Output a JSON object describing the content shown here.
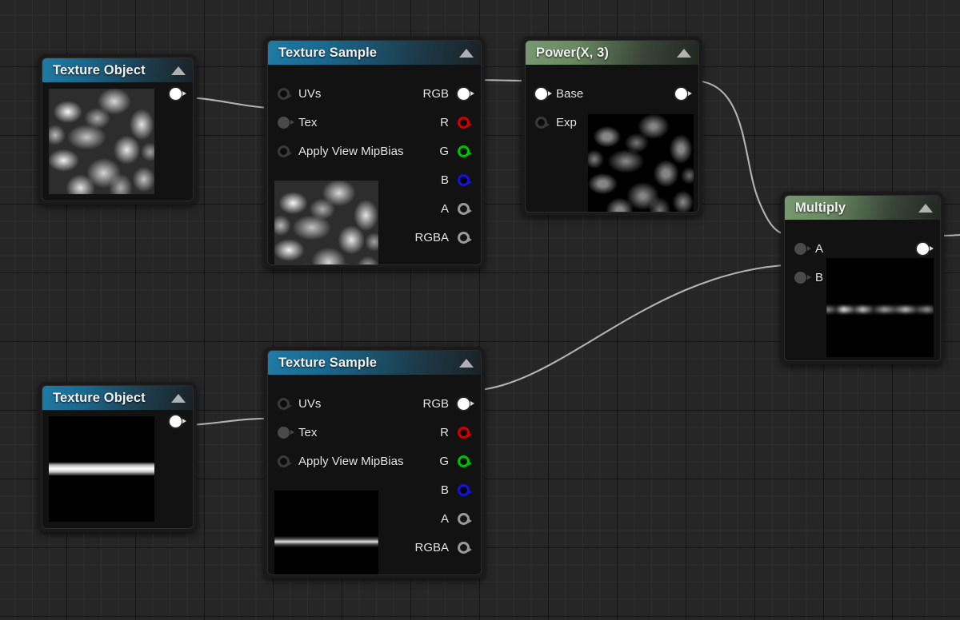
{
  "graph": {
    "editor": "material-node-graph",
    "background_color": "#262626",
    "wire_color": "#b4b4b4",
    "title_color_texture": "#1e7ba6",
    "title_color_math": "#78996f"
  },
  "nodes": {
    "texture_object_top": {
      "title": "Texture Object",
      "header_style": "blue",
      "outputs": [
        {
          "label": "",
          "pin": "white"
        }
      ],
      "thumbnail": "noise-cloud-grayscale"
    },
    "texture_sample_top": {
      "title": "Texture Sample",
      "header_style": "blue",
      "inputs": [
        {
          "label": "UVs",
          "pin": "hollow"
        },
        {
          "label": "Tex",
          "pin": "gray"
        },
        {
          "label": "Apply View MipBias",
          "pin": "hollow"
        }
      ],
      "outputs": [
        {
          "label": "RGB",
          "pin": "white"
        },
        {
          "label": "R",
          "pin": "red"
        },
        {
          "label": "G",
          "pin": "green"
        },
        {
          "label": "B",
          "pin": "blue"
        },
        {
          "label": "A",
          "pin": "grayring"
        },
        {
          "label": "RGBA",
          "pin": "grayring"
        }
      ],
      "thumbnail": "noise-cloud-grayscale"
    },
    "power": {
      "title": "Power(X, 3)",
      "header_style": "green",
      "inputs": [
        {
          "label": "Base",
          "pin": "white"
        },
        {
          "label": "Exp",
          "pin": "hollow"
        }
      ],
      "outputs": [
        {
          "label": "",
          "pin": "white"
        }
      ],
      "thumbnail": "noise-cloud-darkened"
    },
    "texture_object_bottom": {
      "title": "Texture Object",
      "header_style": "blue",
      "outputs": [
        {
          "label": "",
          "pin": "white"
        }
      ],
      "thumbnail": "horizontal-white-stripe"
    },
    "texture_sample_bottom": {
      "title": "Texture Sample",
      "header_style": "blue",
      "inputs": [
        {
          "label": "UVs",
          "pin": "hollow"
        },
        {
          "label": "Tex",
          "pin": "gray"
        },
        {
          "label": "Apply View MipBias",
          "pin": "hollow"
        }
      ],
      "outputs": [
        {
          "label": "RGB",
          "pin": "white"
        },
        {
          "label": "R",
          "pin": "red"
        },
        {
          "label": "G",
          "pin": "green"
        },
        {
          "label": "B",
          "pin": "blue"
        },
        {
          "label": "A",
          "pin": "grayring"
        },
        {
          "label": "RGBA",
          "pin": "grayring"
        }
      ],
      "thumbnail": "horizontal-white-stripe"
    },
    "multiply": {
      "title": "Multiply",
      "header_style": "green",
      "inputs": [
        {
          "label": "A",
          "pin": "gray"
        },
        {
          "label": "B",
          "pin": "gray"
        }
      ],
      "outputs": [
        {
          "label": "",
          "pin": "white"
        }
      ],
      "thumbnail": "noisy-horizontal-stripe-dark"
    }
  },
  "connections": [
    {
      "from": "texture_object_top.out",
      "to": "texture_sample_top.Tex"
    },
    {
      "from": "texture_sample_top.RGB",
      "to": "power.Base"
    },
    {
      "from": "power.out",
      "to": "multiply.A"
    },
    {
      "from": "texture_object_bottom.out",
      "to": "texture_sample_bottom.Tex"
    },
    {
      "from": "texture_sample_bottom.RGB",
      "to": "multiply.B"
    },
    {
      "from": "multiply.out",
      "to": "offscreen"
    }
  ]
}
